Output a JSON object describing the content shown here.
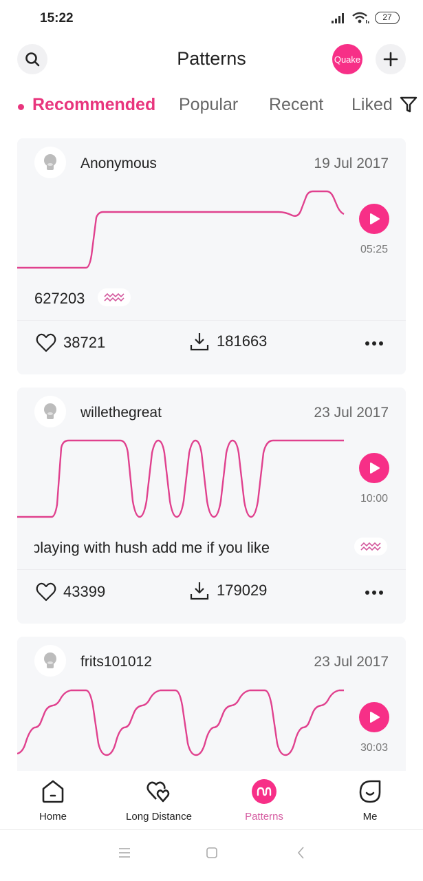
{
  "status_bar": {
    "time": "15:22",
    "battery": "27"
  },
  "header": {
    "title": "Patterns",
    "quake_label": "Quake"
  },
  "tabs": [
    {
      "label": "Recommended",
      "active": true
    },
    {
      "label": "Popular",
      "active": false
    },
    {
      "label": "Recent",
      "active": false
    },
    {
      "label": "Liked",
      "active": false
    }
  ],
  "accent_color": "#f72f87",
  "patterns": [
    {
      "username": "Anonymous",
      "date": "19 Jul 2017",
      "duration": "05:25",
      "description": "627203",
      "likes": "38721",
      "downloads": "181663"
    },
    {
      "username": "willethegreat",
      "date": "23 Jul 2017",
      "duration": "10:00",
      "description": "playing with hush add me if you like",
      "likes": "43399",
      "downloads": "179029"
    },
    {
      "username": "frits101012",
      "date": "23 Jul 2017",
      "duration": "30:03"
    }
  ],
  "bottom_nav": [
    {
      "label": "Home",
      "icon": "home-icon"
    },
    {
      "label": "Long Distance",
      "icon": "hearts-icon"
    },
    {
      "label": "Patterns",
      "icon": "wave-icon",
      "active": true
    },
    {
      "label": "Me",
      "icon": "face-icon"
    }
  ]
}
